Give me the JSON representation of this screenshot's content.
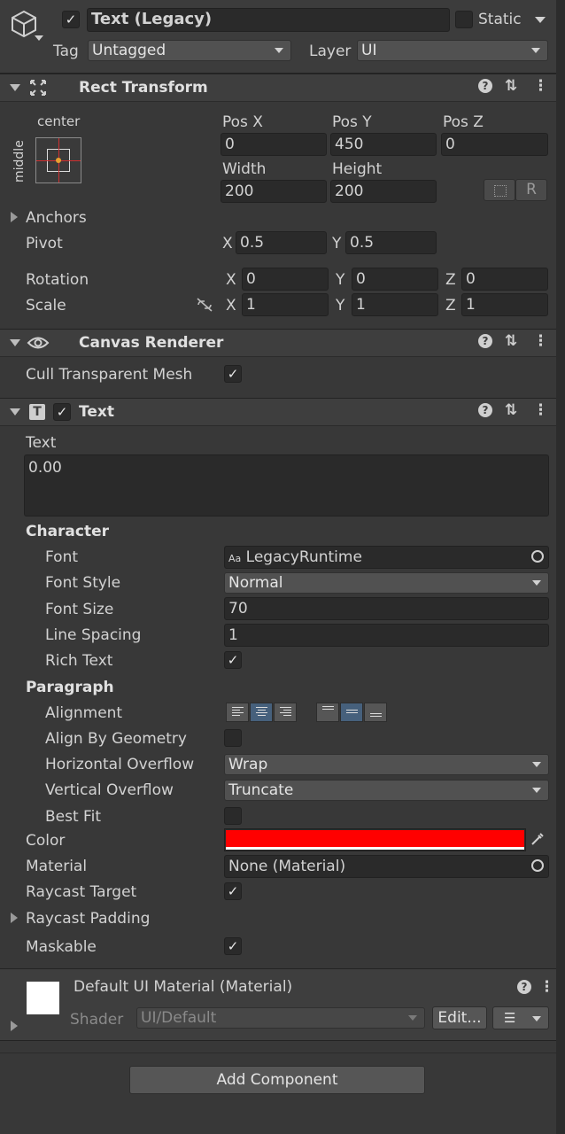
{
  "object": {
    "active": true,
    "name": "Text (Legacy)",
    "static_label": "Static",
    "tag_label": "Tag",
    "tag_value": "Untagged",
    "layer_label": "Layer",
    "layer_value": "UI"
  },
  "rect_transform": {
    "title": "Rect Transform",
    "anchor_h": "center",
    "anchor_v": "middle",
    "pos_x_label": "Pos X",
    "pos_x": "0",
    "pos_y_label": "Pos Y",
    "pos_y": "450",
    "pos_z_label": "Pos Z",
    "pos_z": "0",
    "width_label": "Width",
    "width": "200",
    "height_label": "Height",
    "height": "200",
    "r_button": "R",
    "anchors_label": "Anchors",
    "pivot_label": "Pivot",
    "pivot_x_label": "X",
    "pivot_x": "0.5",
    "pivot_y_label": "Y",
    "pivot_y": "0.5",
    "rotation_label": "Rotation",
    "rot_x_label": "X",
    "rot_x": "0",
    "rot_y_label": "Y",
    "rot_y": "0",
    "rot_z_label": "Z",
    "rot_z": "0",
    "scale_label": "Scale",
    "scale_x_label": "X",
    "scale_x": "1",
    "scale_y_label": "Y",
    "scale_y": "1",
    "scale_z_label": "Z",
    "scale_z": "1"
  },
  "canvas_renderer": {
    "title": "Canvas Renderer",
    "cull_label": "Cull Transparent Mesh",
    "cull_checked": true
  },
  "text": {
    "title": "Text",
    "enabled": true,
    "text_label": "Text",
    "text_value": "0.00",
    "character_label": "Character",
    "font_label": "Font",
    "font_prefix": "Aa",
    "font_value": "LegacyRuntime",
    "font_style_label": "Font Style",
    "font_style_value": "Normal",
    "font_size_label": "Font Size",
    "font_size_value": "70",
    "line_spacing_label": "Line Spacing",
    "line_spacing_value": "1",
    "rich_text_label": "Rich Text",
    "rich_text_checked": true,
    "paragraph_label": "Paragraph",
    "alignment_label": "Alignment",
    "align_by_geometry_label": "Align By Geometry",
    "align_by_geometry_checked": false,
    "h_overflow_label": "Horizontal Overflow",
    "h_overflow_value": "Wrap",
    "v_overflow_label": "Vertical Overflow",
    "v_overflow_value": "Truncate",
    "best_fit_label": "Best Fit",
    "best_fit_checked": false,
    "color_label": "Color",
    "color_value": "#ff0000",
    "material_label": "Material",
    "material_value": "None (Material)",
    "raycast_target_label": "Raycast Target",
    "raycast_target_checked": true,
    "raycast_padding_label": "Raycast Padding",
    "maskable_label": "Maskable",
    "maskable_checked": true
  },
  "material": {
    "title": "Default UI Material (Material)",
    "shader_label": "Shader",
    "shader_value": "UI/Default",
    "edit_button": "Edit..."
  },
  "add_component_button": "Add Component"
}
